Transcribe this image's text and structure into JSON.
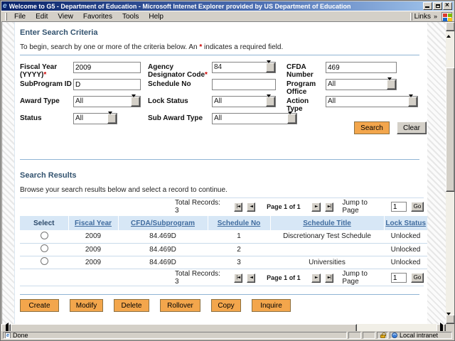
{
  "window": {
    "title": "Welcome to G5 - Department of Education - Microsoft Internet Explorer provided by US Department of Education",
    "menu": [
      "File",
      "Edit",
      "View",
      "Favorites",
      "Tools",
      "Help"
    ],
    "links_label": "Links",
    "links_chevron": "»",
    "status_done": "Done",
    "status_zone": "Local intranet"
  },
  "icons": {
    "first_page": "|◄",
    "prev_page": "◄",
    "next_page": "►",
    "last_page": "►|"
  },
  "colors": {
    "titlebar_left": "#0a246a",
    "titlebar_right": "#a6caf0",
    "chrome_gray": "#d4d0c8",
    "accent_orange": "#f3a64c",
    "heading_navy": "#33536f",
    "link_blue": "#3f6b9e",
    "divider_blue": "#8fb4d4",
    "table_header_bg": "#d7e7f6",
    "required_red": "#cc0000"
  },
  "search_criteria": {
    "heading": "Enter Search Criteria",
    "instructions_prefix": "To begin, search by one or more of the criteria below. An ",
    "instructions_star": "*",
    "instructions_suffix": " indicates a required field.",
    "fields": {
      "fiscal_year": {
        "label": "Fiscal Year (YYYY)",
        "required": "*",
        "value": "2009"
      },
      "agency_designator": {
        "label": "Agency Designator Code",
        "required": "*",
        "value": "84"
      },
      "cfda_number": {
        "label": "CFDA Number",
        "value": "469"
      },
      "subprogram_id": {
        "label": "SubProgram ID",
        "value": "D"
      },
      "schedule_no": {
        "label": "Schedule No",
        "value": ""
      },
      "program_office": {
        "label": "Program Office",
        "value": "All"
      },
      "award_type": {
        "label": "Award Type",
        "value": "All"
      },
      "lock_status": {
        "label": "Lock Status",
        "value": "All"
      },
      "action_type": {
        "label": "Action Type",
        "value": "All"
      },
      "status": {
        "label": "Status",
        "value": "All"
      },
      "sub_award_type": {
        "label": "Sub Award Type",
        "value": "All"
      }
    },
    "search_button": "Search",
    "clear_button": "Clear"
  },
  "search_results": {
    "heading": "Search Results",
    "instructions": "Browse your search results below and select a record to continue.",
    "pagination": {
      "total": "Total Records: 3",
      "page": "Page 1 of 1",
      "jump": "Jump to Page",
      "jump_value": "1",
      "go": "Go"
    },
    "table": {
      "columns": [
        "Select",
        "Fiscal Year",
        "CFDA/Subprogram",
        "Schedule No",
        "Schedule Title",
        "Lock Status"
      ],
      "rows": [
        {
          "fiscal_year": "2009",
          "cfda_subprogram": "84.469D",
          "schedule_no": "1",
          "schedule_title": "Discretionary Test Schedule",
          "lock_status": "Unlocked"
        },
        {
          "fiscal_year": "2009",
          "cfda_subprogram": "84.469D",
          "schedule_no": "2",
          "schedule_title": "",
          "lock_status": "Unlocked"
        },
        {
          "fiscal_year": "2009",
          "cfda_subprogram": "84.469D",
          "schedule_no": "3",
          "schedule_title": "Universities",
          "lock_status": "Unlocked"
        }
      ]
    },
    "actions": [
      "Create",
      "Modify",
      "Delete",
      "Rollover",
      "Copy",
      "Inquire"
    ]
  }
}
